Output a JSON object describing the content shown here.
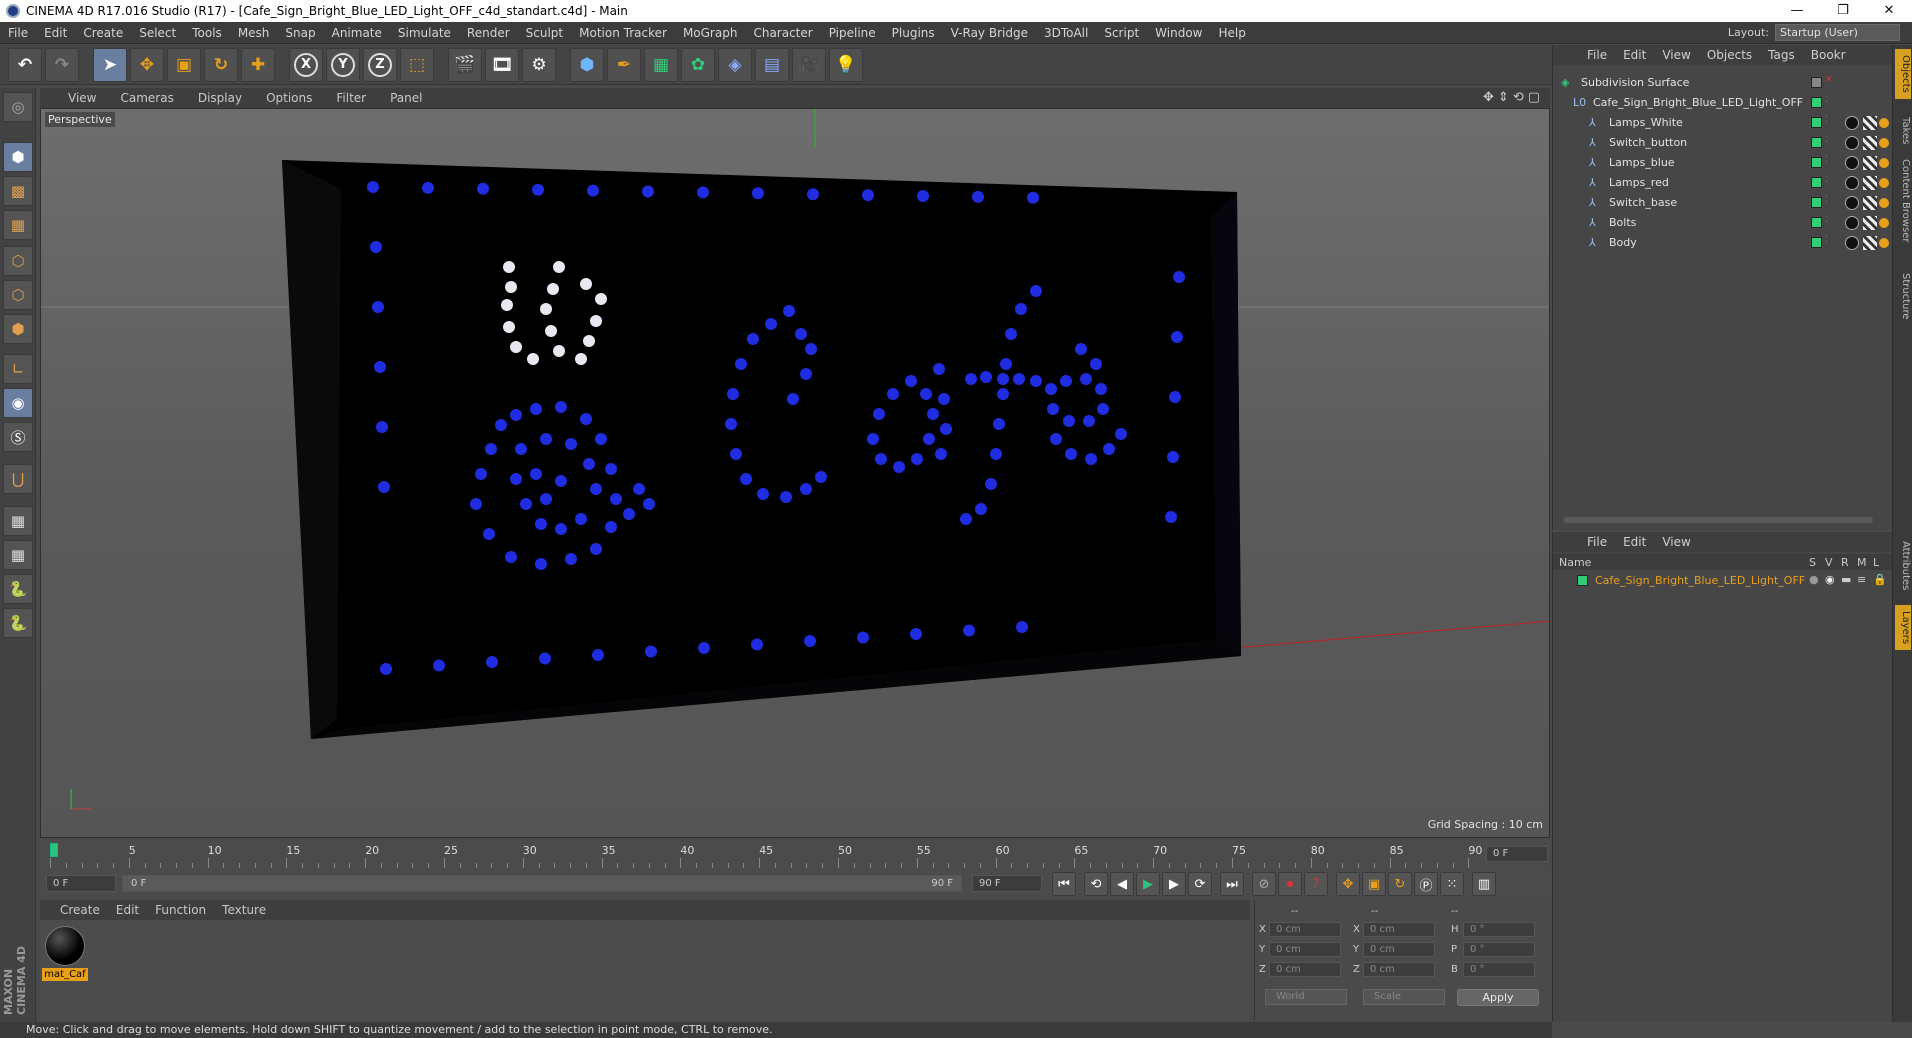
{
  "window": {
    "title": "CINEMA 4D R17.016 Studio (R17) - [Cafe_Sign_Bright_Blue_LED_Light_OFF_c4d_standart.c4d] - Main",
    "controls": [
      "—",
      "❐",
      "✕"
    ]
  },
  "menu": [
    "File",
    "Edit",
    "Create",
    "Select",
    "Tools",
    "Mesh",
    "Snap",
    "Animate",
    "Simulate",
    "Render",
    "Sculpt",
    "Motion Tracker",
    "MoGraph",
    "Character",
    "Pipeline",
    "Plugins",
    "V-Ray Bridge",
    "3DToAll",
    "Script",
    "Window",
    "Help"
  ],
  "layout": {
    "label": "Layout:",
    "value": "Startup (User)"
  },
  "toolbar": {
    "axis_x": "X",
    "axis_y": "Y",
    "axis_z": "Z"
  },
  "viewport": {
    "menu": [
      "View",
      "Cameras",
      "Display",
      "Options",
      "Filter",
      "Panel"
    ],
    "label": "Perspective",
    "grid_spacing": "Grid Spacing : 10 cm",
    "sign_text": "Cafe",
    "colors": {
      "led_blue": "#1f2ce0",
      "led_white": "#e8e8f0",
      "sign_body": "#020204"
    }
  },
  "timeline": {
    "ticks": [
      "0",
      "5",
      "10",
      "15",
      "20",
      "25",
      "30",
      "35",
      "40",
      "45",
      "50",
      "55",
      "60",
      "65",
      "70",
      "75",
      "80",
      "85",
      "90"
    ],
    "current_frame": "0 F"
  },
  "transport": {
    "start": "0 F",
    "range_start": "0 F",
    "range_end": "90 F",
    "end": "90 F"
  },
  "materials": {
    "menu": [
      "Create",
      "Edit",
      "Function",
      "Texture"
    ],
    "items": [
      {
        "name": "mat_Caf"
      }
    ]
  },
  "coordinates": {
    "headers": [
      "--",
      "--",
      "--"
    ],
    "rows": [
      {
        "a": "X",
        "av": "0 cm",
        "b": "X",
        "bv": "0 cm",
        "c": "H",
        "cv": "0 °"
      },
      {
        "a": "Y",
        "av": "0 cm",
        "b": "Y",
        "bv": "0 cm",
        "c": "P",
        "cv": "0 °"
      },
      {
        "a": "Z",
        "av": "0 cm",
        "b": "Z",
        "bv": "0 cm",
        "c": "B",
        "cv": "0 °"
      }
    ],
    "mode": "World",
    "size_mode": "Scale",
    "apply": "Apply"
  },
  "status": "Move: Click and drag to move elements. Hold down SHIFT to quantize movement / add to the selection in point mode, CTRL to remove.",
  "objects": {
    "menu": [
      "File",
      "Edit",
      "View",
      "Objects",
      "Tags",
      "Bookr"
    ],
    "items": [
      {
        "name": "Subdivision Surface"
      },
      {
        "name": "Cafe_Sign_Bright_Blue_LED_Light_OFF"
      },
      {
        "name": "Lamps_White"
      },
      {
        "name": "Switch_button"
      },
      {
        "name": "Lamps_blue"
      },
      {
        "name": "Lamps_red"
      },
      {
        "name": "Switch_base"
      },
      {
        "name": "Bolts"
      },
      {
        "name": "Body"
      }
    ]
  },
  "layers": {
    "menu": [
      "File",
      "Edit",
      "View"
    ],
    "header_name": "Name",
    "header_flags": [
      "S",
      "V",
      "R",
      "M",
      "L"
    ],
    "item": "Cafe_Sign_Bright_Blue_LED_Light_OFF"
  },
  "side_tabs": [
    "Objects",
    "Takes",
    "Content Browser",
    "Structure",
    "Attributes",
    "Layers"
  ],
  "maxon": "MAXON CINEMA 4D"
}
